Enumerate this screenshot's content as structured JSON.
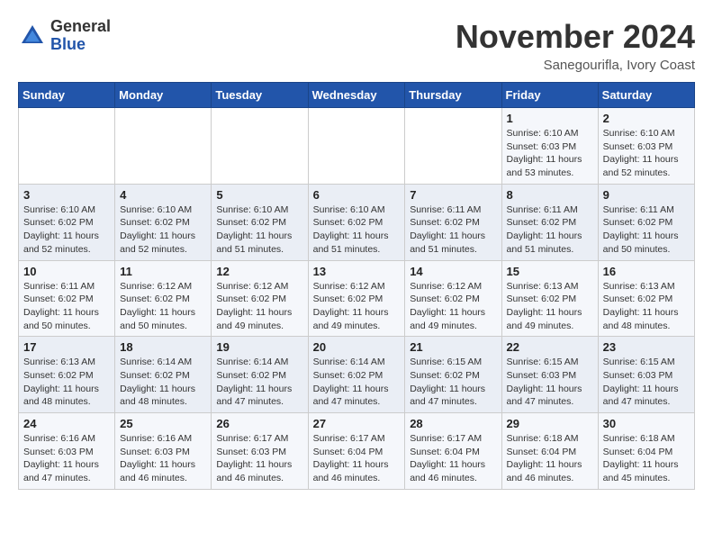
{
  "header": {
    "logo_line1": "General",
    "logo_line2": "Blue",
    "month_title": "November 2024",
    "location": "Sanegourifla, Ivory Coast"
  },
  "weekdays": [
    "Sunday",
    "Monday",
    "Tuesday",
    "Wednesday",
    "Thursday",
    "Friday",
    "Saturday"
  ],
  "weeks": [
    [
      {
        "day": "",
        "info": ""
      },
      {
        "day": "",
        "info": ""
      },
      {
        "day": "",
        "info": ""
      },
      {
        "day": "",
        "info": ""
      },
      {
        "day": "",
        "info": ""
      },
      {
        "day": "1",
        "info": "Sunrise: 6:10 AM\nSunset: 6:03 PM\nDaylight: 11 hours\nand 53 minutes."
      },
      {
        "day": "2",
        "info": "Sunrise: 6:10 AM\nSunset: 6:03 PM\nDaylight: 11 hours\nand 52 minutes."
      }
    ],
    [
      {
        "day": "3",
        "info": "Sunrise: 6:10 AM\nSunset: 6:02 PM\nDaylight: 11 hours\nand 52 minutes."
      },
      {
        "day": "4",
        "info": "Sunrise: 6:10 AM\nSunset: 6:02 PM\nDaylight: 11 hours\nand 52 minutes."
      },
      {
        "day": "5",
        "info": "Sunrise: 6:10 AM\nSunset: 6:02 PM\nDaylight: 11 hours\nand 51 minutes."
      },
      {
        "day": "6",
        "info": "Sunrise: 6:10 AM\nSunset: 6:02 PM\nDaylight: 11 hours\nand 51 minutes."
      },
      {
        "day": "7",
        "info": "Sunrise: 6:11 AM\nSunset: 6:02 PM\nDaylight: 11 hours\nand 51 minutes."
      },
      {
        "day": "8",
        "info": "Sunrise: 6:11 AM\nSunset: 6:02 PM\nDaylight: 11 hours\nand 51 minutes."
      },
      {
        "day": "9",
        "info": "Sunrise: 6:11 AM\nSunset: 6:02 PM\nDaylight: 11 hours\nand 50 minutes."
      }
    ],
    [
      {
        "day": "10",
        "info": "Sunrise: 6:11 AM\nSunset: 6:02 PM\nDaylight: 11 hours\nand 50 minutes."
      },
      {
        "day": "11",
        "info": "Sunrise: 6:12 AM\nSunset: 6:02 PM\nDaylight: 11 hours\nand 50 minutes."
      },
      {
        "day": "12",
        "info": "Sunrise: 6:12 AM\nSunset: 6:02 PM\nDaylight: 11 hours\nand 49 minutes."
      },
      {
        "day": "13",
        "info": "Sunrise: 6:12 AM\nSunset: 6:02 PM\nDaylight: 11 hours\nand 49 minutes."
      },
      {
        "day": "14",
        "info": "Sunrise: 6:12 AM\nSunset: 6:02 PM\nDaylight: 11 hours\nand 49 minutes."
      },
      {
        "day": "15",
        "info": "Sunrise: 6:13 AM\nSunset: 6:02 PM\nDaylight: 11 hours\nand 49 minutes."
      },
      {
        "day": "16",
        "info": "Sunrise: 6:13 AM\nSunset: 6:02 PM\nDaylight: 11 hours\nand 48 minutes."
      }
    ],
    [
      {
        "day": "17",
        "info": "Sunrise: 6:13 AM\nSunset: 6:02 PM\nDaylight: 11 hours\nand 48 minutes."
      },
      {
        "day": "18",
        "info": "Sunrise: 6:14 AM\nSunset: 6:02 PM\nDaylight: 11 hours\nand 48 minutes."
      },
      {
        "day": "19",
        "info": "Sunrise: 6:14 AM\nSunset: 6:02 PM\nDaylight: 11 hours\nand 47 minutes."
      },
      {
        "day": "20",
        "info": "Sunrise: 6:14 AM\nSunset: 6:02 PM\nDaylight: 11 hours\nand 47 minutes."
      },
      {
        "day": "21",
        "info": "Sunrise: 6:15 AM\nSunset: 6:02 PM\nDaylight: 11 hours\nand 47 minutes."
      },
      {
        "day": "22",
        "info": "Sunrise: 6:15 AM\nSunset: 6:03 PM\nDaylight: 11 hours\nand 47 minutes."
      },
      {
        "day": "23",
        "info": "Sunrise: 6:15 AM\nSunset: 6:03 PM\nDaylight: 11 hours\nand 47 minutes."
      }
    ],
    [
      {
        "day": "24",
        "info": "Sunrise: 6:16 AM\nSunset: 6:03 PM\nDaylight: 11 hours\nand 47 minutes."
      },
      {
        "day": "25",
        "info": "Sunrise: 6:16 AM\nSunset: 6:03 PM\nDaylight: 11 hours\nand 46 minutes."
      },
      {
        "day": "26",
        "info": "Sunrise: 6:17 AM\nSunset: 6:03 PM\nDaylight: 11 hours\nand 46 minutes."
      },
      {
        "day": "27",
        "info": "Sunrise: 6:17 AM\nSunset: 6:04 PM\nDaylight: 11 hours\nand 46 minutes."
      },
      {
        "day": "28",
        "info": "Sunrise: 6:17 AM\nSunset: 6:04 PM\nDaylight: 11 hours\nand 46 minutes."
      },
      {
        "day": "29",
        "info": "Sunrise: 6:18 AM\nSunset: 6:04 PM\nDaylight: 11 hours\nand 46 minutes."
      },
      {
        "day": "30",
        "info": "Sunrise: 6:18 AM\nSunset: 6:04 PM\nDaylight: 11 hours\nand 45 minutes."
      }
    ]
  ]
}
